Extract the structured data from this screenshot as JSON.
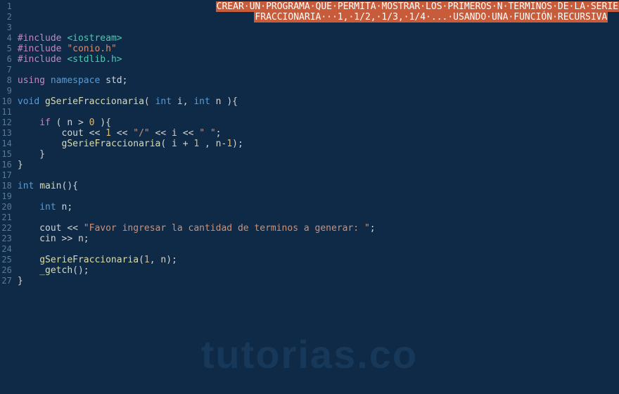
{
  "watermark": "tutorias.co",
  "lines": [
    {
      "num": 1,
      "content": [
        {
          "cls": "hl-dot",
          "raw": "                                    "
        },
        {
          "cls": "hl-comment",
          "raw": "CREAR·UN·PROGRAMA·QUE·PERMITA·MOSTRAR·LOS·PRIMEROS·N·TERMINOS·DE·LA·SERIE"
        }
      ]
    },
    {
      "num": 2,
      "content": [
        {
          "cls": "hl-dot",
          "raw": "                                           "
        },
        {
          "cls": "hl-comment",
          "raw": "FRACCIONARIA···1,·1/2,·1/3,·1/4·...·USANDO·UNA·FUNCIÓN·RECURSIVA"
        }
      ]
    },
    {
      "num": 3,
      "content": []
    },
    {
      "num": 4,
      "content": [
        {
          "cls": "tok-preproc",
          "raw": "#include "
        },
        {
          "cls": "tok-angled",
          "raw": "<iostream>"
        }
      ]
    },
    {
      "num": 5,
      "content": [
        {
          "cls": "tok-preproc",
          "raw": "#include "
        },
        {
          "cls": "tok-string",
          "raw": "\"conio.h\""
        }
      ]
    },
    {
      "num": 6,
      "content": [
        {
          "cls": "tok-preproc",
          "raw": "#include "
        },
        {
          "cls": "tok-angled",
          "raw": "<stdlib.h>"
        }
      ]
    },
    {
      "num": 7,
      "content": []
    },
    {
      "num": 8,
      "content": [
        {
          "cls": "tok-keyword2",
          "raw": "using"
        },
        {
          "cls": "tok-plain",
          "raw": " "
        },
        {
          "cls": "tok-keyword",
          "raw": "namespace"
        },
        {
          "cls": "tok-plain",
          "raw": " std;"
        }
      ]
    },
    {
      "num": 9,
      "content": []
    },
    {
      "num": 10,
      "content": [
        {
          "cls": "tok-type",
          "raw": "void"
        },
        {
          "cls": "tok-plain",
          "raw": " "
        },
        {
          "cls": "tok-func",
          "raw": "gSerieFraccionaria"
        },
        {
          "cls": "tok-plain",
          "raw": "( "
        },
        {
          "cls": "tok-type",
          "raw": "int"
        },
        {
          "cls": "tok-plain",
          "raw": " i, "
        },
        {
          "cls": "tok-type",
          "raw": "int"
        },
        {
          "cls": "tok-plain",
          "raw": " n ){"
        }
      ]
    },
    {
      "num": 11,
      "content": []
    },
    {
      "num": 12,
      "content": [
        {
          "cls": "tok-plain",
          "raw": "    "
        },
        {
          "cls": "tok-keyword2",
          "raw": "if"
        },
        {
          "cls": "tok-plain",
          "raw": " ( n > "
        },
        {
          "cls": "tok-num-orange",
          "raw": "0"
        },
        {
          "cls": "tok-plain",
          "raw": " ){"
        }
      ]
    },
    {
      "num": 13,
      "content": [
        {
          "cls": "tok-plain",
          "raw": "        cout << "
        },
        {
          "cls": "tok-num-orange",
          "raw": "1"
        },
        {
          "cls": "tok-plain",
          "raw": " << "
        },
        {
          "cls": "tok-string",
          "raw": "\"/\""
        },
        {
          "cls": "tok-plain",
          "raw": " << i << "
        },
        {
          "cls": "tok-string",
          "raw": "\" \""
        },
        {
          "cls": "tok-plain",
          "raw": ";"
        }
      ]
    },
    {
      "num": 14,
      "content": [
        {
          "cls": "tok-plain",
          "raw": "        "
        },
        {
          "cls": "tok-func",
          "raw": "gSerieFraccionaria"
        },
        {
          "cls": "tok-plain",
          "raw": "( i + "
        },
        {
          "cls": "tok-num-orange",
          "raw": "1"
        },
        {
          "cls": "tok-plain",
          "raw": " , n-"
        },
        {
          "cls": "tok-num-orange",
          "raw": "1"
        },
        {
          "cls": "tok-plain",
          "raw": ");"
        }
      ]
    },
    {
      "num": 15,
      "content": [
        {
          "cls": "tok-plain",
          "raw": "    }"
        }
      ]
    },
    {
      "num": 16,
      "content": [
        {
          "cls": "tok-plain",
          "raw": "}"
        }
      ]
    },
    {
      "num": 17,
      "content": []
    },
    {
      "num": 18,
      "content": [
        {
          "cls": "tok-type",
          "raw": "int"
        },
        {
          "cls": "tok-plain",
          "raw": " "
        },
        {
          "cls": "tok-func",
          "raw": "main"
        },
        {
          "cls": "tok-plain",
          "raw": "(){"
        }
      ]
    },
    {
      "num": 19,
      "content": []
    },
    {
      "num": 20,
      "content": [
        {
          "cls": "tok-plain",
          "raw": "    "
        },
        {
          "cls": "tok-type",
          "raw": "int"
        },
        {
          "cls": "tok-plain",
          "raw": " n;"
        }
      ]
    },
    {
      "num": 21,
      "content": []
    },
    {
      "num": 22,
      "content": [
        {
          "cls": "tok-plain",
          "raw": "    cout << "
        },
        {
          "cls": "tok-string",
          "raw": "\"Favor ingresar la cantidad de terminos a generar: \""
        },
        {
          "cls": "tok-plain",
          "raw": ";"
        }
      ]
    },
    {
      "num": 23,
      "content": [
        {
          "cls": "tok-plain",
          "raw": "    cin >> n;"
        }
      ]
    },
    {
      "num": 24,
      "content": []
    },
    {
      "num": 25,
      "content": [
        {
          "cls": "tok-plain",
          "raw": "    "
        },
        {
          "cls": "tok-func",
          "raw": "gSerieFraccionaria"
        },
        {
          "cls": "tok-plain",
          "raw": "("
        },
        {
          "cls": "tok-num-orange",
          "raw": "1"
        },
        {
          "cls": "tok-plain",
          "raw": ", n);"
        }
      ]
    },
    {
      "num": 26,
      "content": [
        {
          "cls": "tok-plain",
          "raw": "    "
        },
        {
          "cls": "tok-func",
          "raw": "_getch"
        },
        {
          "cls": "tok-plain",
          "raw": "();"
        }
      ]
    },
    {
      "num": 27,
      "content": [
        {
          "cls": "tok-plain",
          "raw": "}"
        }
      ]
    }
  ]
}
